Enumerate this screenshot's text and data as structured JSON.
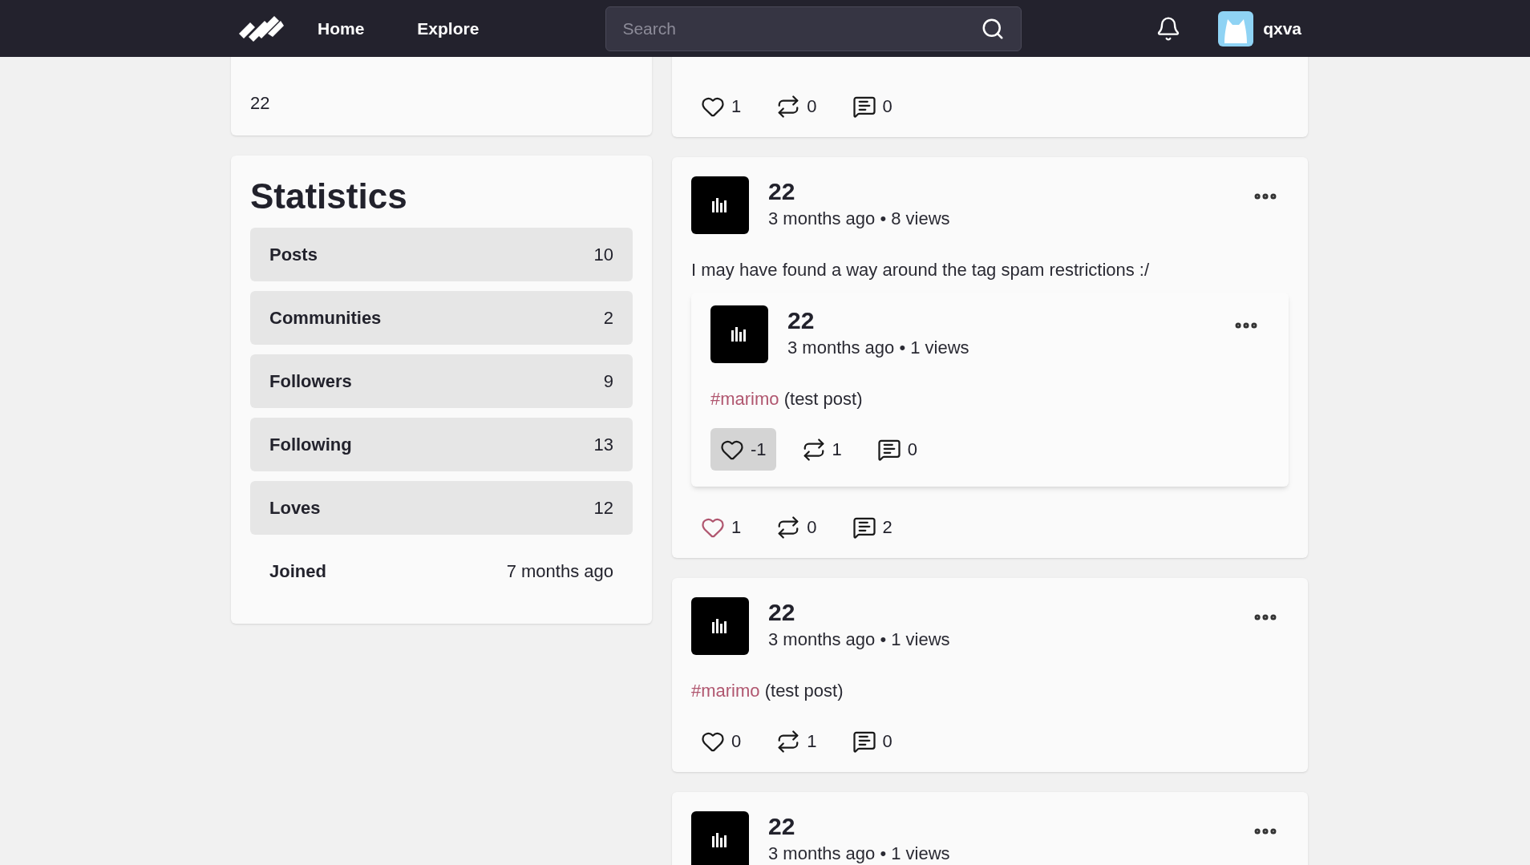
{
  "nav": {
    "links": [
      {
        "label": "Home"
      },
      {
        "label": "Explore"
      }
    ],
    "search": {
      "placeholder": "Search"
    },
    "user": {
      "name": "qxva"
    }
  },
  "about": {
    "text": "22"
  },
  "statistics": {
    "title": "Statistics",
    "rows": [
      {
        "label": "Posts",
        "value": "10"
      },
      {
        "label": "Communities",
        "value": "2"
      },
      {
        "label": "Followers",
        "value": "9"
      },
      {
        "label": "Following",
        "value": "13"
      },
      {
        "label": "Loves",
        "value": "12"
      }
    ],
    "joined": {
      "label": "Joined",
      "value": "7 months ago"
    }
  },
  "posts": [
    {
      "actions": {
        "likes": "1",
        "liked": false,
        "pressed": false,
        "reposts": "0",
        "comments": "0"
      }
    },
    {
      "author": "22",
      "meta": "3 months ago • 8 views",
      "body": [
        {
          "kind": "text",
          "text": "I may have found a way around the tag spam restrictions :/"
        }
      ],
      "quote": {
        "author": "22",
        "meta": "3 months ago • 1 views",
        "body": [
          {
            "kind": "tag",
            "text": "#marimo"
          },
          {
            "kind": "text",
            "text": " (test post)"
          }
        ],
        "actions": {
          "likes": "-1",
          "liked": false,
          "pressed": true,
          "reposts": "1",
          "comments": "0"
        }
      },
      "actions": {
        "likes": "1",
        "liked": true,
        "pressed": false,
        "reposts": "0",
        "comments": "2"
      }
    },
    {
      "author": "22",
      "meta": "3 months ago • 1 views",
      "body": [
        {
          "kind": "tag",
          "text": "#marimo"
        },
        {
          "kind": "text",
          "text": " (test post)"
        }
      ],
      "actions": {
        "likes": "0",
        "liked": false,
        "pressed": false,
        "reposts": "1",
        "comments": "0"
      }
    },
    {
      "author": "22",
      "meta": "3 months ago • 1 views"
    }
  ]
}
